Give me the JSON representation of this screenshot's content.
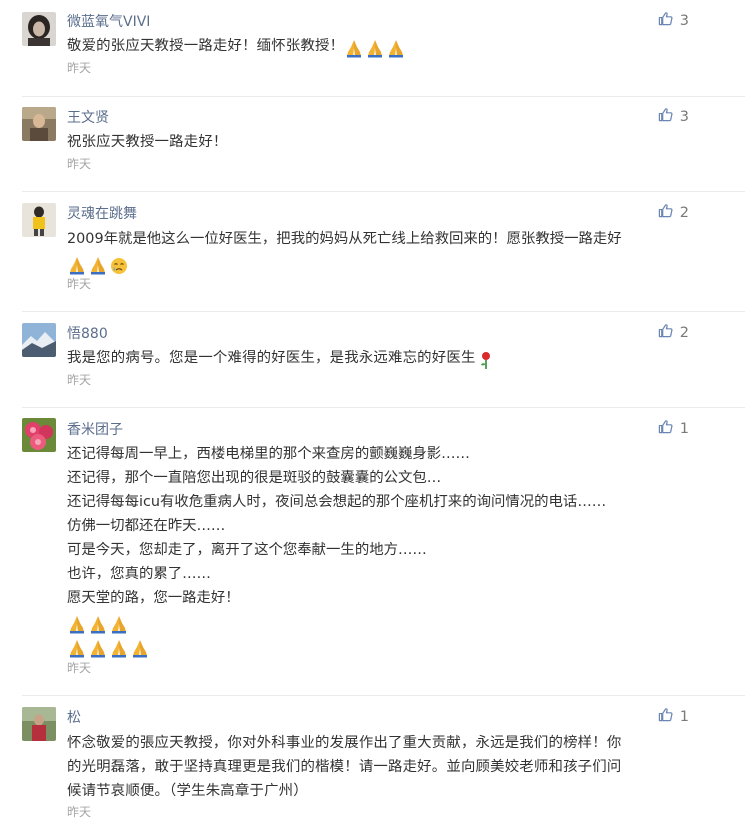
{
  "comments": [
    {
      "username": "微蓝氧气VIVI",
      "text_lines": [
        "敬爱的张应天教授一路走好！缅怀张教授！"
      ],
      "emoji_after_first_line": [
        "folded-hands",
        "folded-hands",
        "folded-hands"
      ],
      "time": "昨天",
      "likes": "3",
      "avatar": "avatar-woman-dark-hair"
    },
    {
      "username": "王文贤",
      "text_lines": [
        "祝张应天教授一路走好！"
      ],
      "time": "昨天",
      "likes": "3",
      "avatar": "avatar-elderly-man"
    },
    {
      "username": "灵魂在跳舞",
      "text_lines": [
        "2009年就是他这么一位好医生，把我的妈妈从死亡线上给救回来的！愿张教授一路走好"
      ],
      "emoji_rows": [
        [
          "folded-hands",
          "folded-hands",
          "crying-face"
        ]
      ],
      "time": "昨天",
      "likes": "2",
      "avatar": "avatar-child-yellow"
    },
    {
      "username": "悟880",
      "text_lines": [
        "我是您的病号。您是一个难得的好医生，是我永远难忘的好医生"
      ],
      "emoji_after_first_line": [
        "rose"
      ],
      "time": "昨天",
      "likes": "2",
      "avatar": "avatar-mountains"
    },
    {
      "username": "香米团子",
      "text_lines": [
        "还记得每周一早上，西楼电梯里的那个来查房的颤巍巍身影……",
        "还记得，那个一直陪您出现的很是斑驳的鼓囊囊的公文包…",
        "还记得每每icu有收危重病人时，夜间总会想起的那个座机打来的询问情况的电话……",
        "仿佛一切都还在昨天……",
        "可是今天，您却走了，离开了这个您奉献一生的地方……",
        "也许，您真的累了……",
        "愿天堂的路，您一路走好！"
      ],
      "emoji_rows": [
        [
          "folded-hands",
          "folded-hands",
          "folded-hands"
        ],
        [
          "folded-hands",
          "folded-hands",
          "folded-hands",
          "folded-hands"
        ]
      ],
      "time": "昨天",
      "likes": "1",
      "avatar": "avatar-red-flowers"
    },
    {
      "username": "松",
      "text_lines": [
        "怀念敬爱的張应天教授，你对外科事业的发展作出了重大贡献，永远是我们的榜样！你",
        "的光明磊落，敢于坚持真理更是我们的楷模！请一路走好。並向顾美姣老师和孩子们问",
        "候请节哀顺便。（学生朱高章于广州）"
      ],
      "time": "昨天",
      "likes": "1",
      "avatar": "avatar-person-outdoors"
    }
  ],
  "colors": {
    "username": "#5b6e8c",
    "text": "#333333",
    "time": "#a5a5a5",
    "like_icon": "#6a86b4",
    "divider": "#ebebeb"
  },
  "icons": {
    "like": "thumbs-up-icon"
  }
}
